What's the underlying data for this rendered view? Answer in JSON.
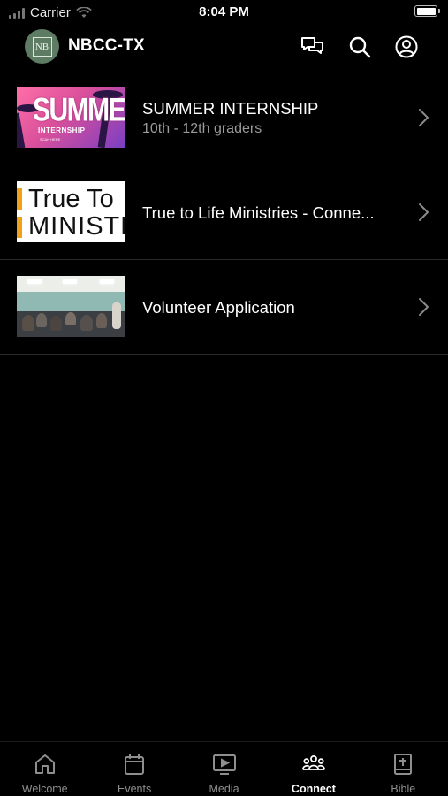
{
  "status_bar": {
    "carrier": "Carrier",
    "time": "8:04 PM"
  },
  "header": {
    "logo_text": "NB",
    "title": "NBCC-TX",
    "icons": [
      "chat-icon",
      "search-icon",
      "account-icon"
    ]
  },
  "items": [
    {
      "title": "SUMMER INTERNSHIP",
      "subtitle": "10th - 12th graders",
      "thumb_main": "SUMMER",
      "thumb_sub": "INTERNSHIP",
      "thumb_small": "SCAN HERE"
    },
    {
      "title": "True to Life Ministries - Conne...",
      "thumb_line1": "True To",
      "thumb_line2": "MINISTR"
    },
    {
      "title": "Volunteer Application"
    }
  ],
  "tabs": [
    {
      "label": "Welcome",
      "icon": "home-icon",
      "active": false
    },
    {
      "label": "Events",
      "icon": "calendar-icon",
      "active": false
    },
    {
      "label": "Media",
      "icon": "media-play-icon",
      "active": false
    },
    {
      "label": "Connect",
      "icon": "people-icon",
      "active": true
    },
    {
      "label": "Bible",
      "icon": "bible-icon",
      "active": false
    }
  ],
  "colors": {
    "background": "#000000",
    "divider": "#2a2a2a",
    "subtitle": "#9a9a9a",
    "tab_inactive": "#8e8e8e",
    "tab_active": "#ffffff"
  }
}
